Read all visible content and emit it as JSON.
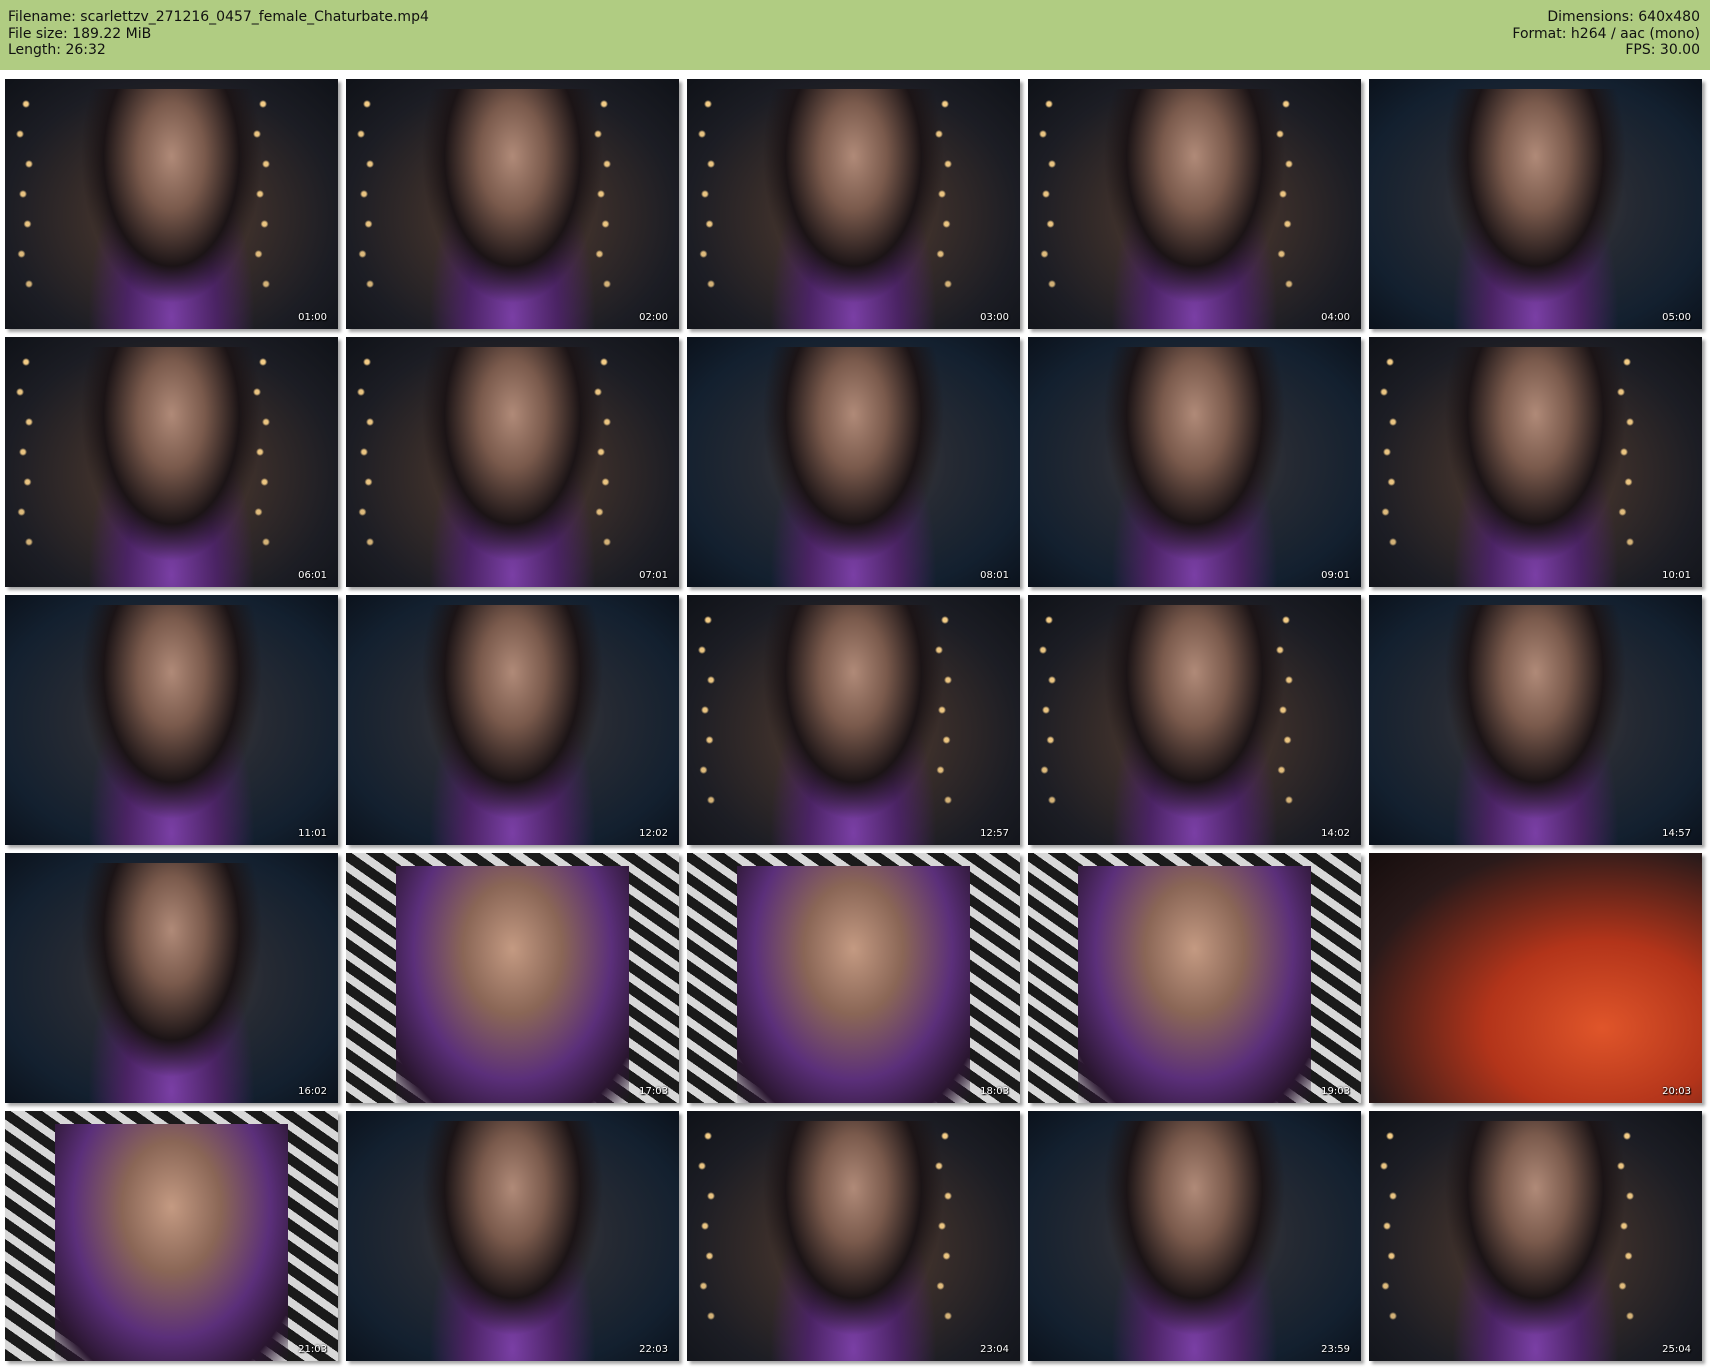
{
  "header": {
    "filename_line": "Filename: scarlettzv_271216_0457_female_Chaturbate.mp4",
    "filesize_line": "File size: 189.22 MiB",
    "length_line": "Length: 26:32",
    "dimensions_line": "Dimensions: 640x480",
    "format_line": "Format: h264 / aac (mono)",
    "fps_line": "FPS: 30.00",
    "background_color": "#b0cc82"
  },
  "thumbnails": [
    {
      "timestamp": "01:00",
      "scene": "lights"
    },
    {
      "timestamp": "02:00",
      "scene": "lights"
    },
    {
      "timestamp": "03:00",
      "scene": "lights"
    },
    {
      "timestamp": "04:00",
      "scene": "lights"
    },
    {
      "timestamp": "05:00",
      "scene": "dark"
    },
    {
      "timestamp": "06:01",
      "scene": "lights"
    },
    {
      "timestamp": "07:01",
      "scene": "lights"
    },
    {
      "timestamp": "08:01",
      "scene": "dark"
    },
    {
      "timestamp": "09:01",
      "scene": "dark"
    },
    {
      "timestamp": "10:01",
      "scene": "lights"
    },
    {
      "timestamp": "11:01",
      "scene": "dark"
    },
    {
      "timestamp": "12:02",
      "scene": "dark"
    },
    {
      "timestamp": "12:57",
      "scene": "lights"
    },
    {
      "timestamp": "14:02",
      "scene": "lights"
    },
    {
      "timestamp": "14:57",
      "scene": "dark"
    },
    {
      "timestamp": "16:02",
      "scene": "dark"
    },
    {
      "timestamp": "17:03",
      "scene": "zebra"
    },
    {
      "timestamp": "18:03",
      "scene": "zebra"
    },
    {
      "timestamp": "19:03",
      "scene": "zebra"
    },
    {
      "timestamp": "20:03",
      "scene": "red"
    },
    {
      "timestamp": "21:03",
      "scene": "zebra"
    },
    {
      "timestamp": "22:03",
      "scene": "dark"
    },
    {
      "timestamp": "23:04",
      "scene": "lights"
    },
    {
      "timestamp": "23:59",
      "scene": "dark"
    },
    {
      "timestamp": "25:04",
      "scene": "lights"
    }
  ]
}
